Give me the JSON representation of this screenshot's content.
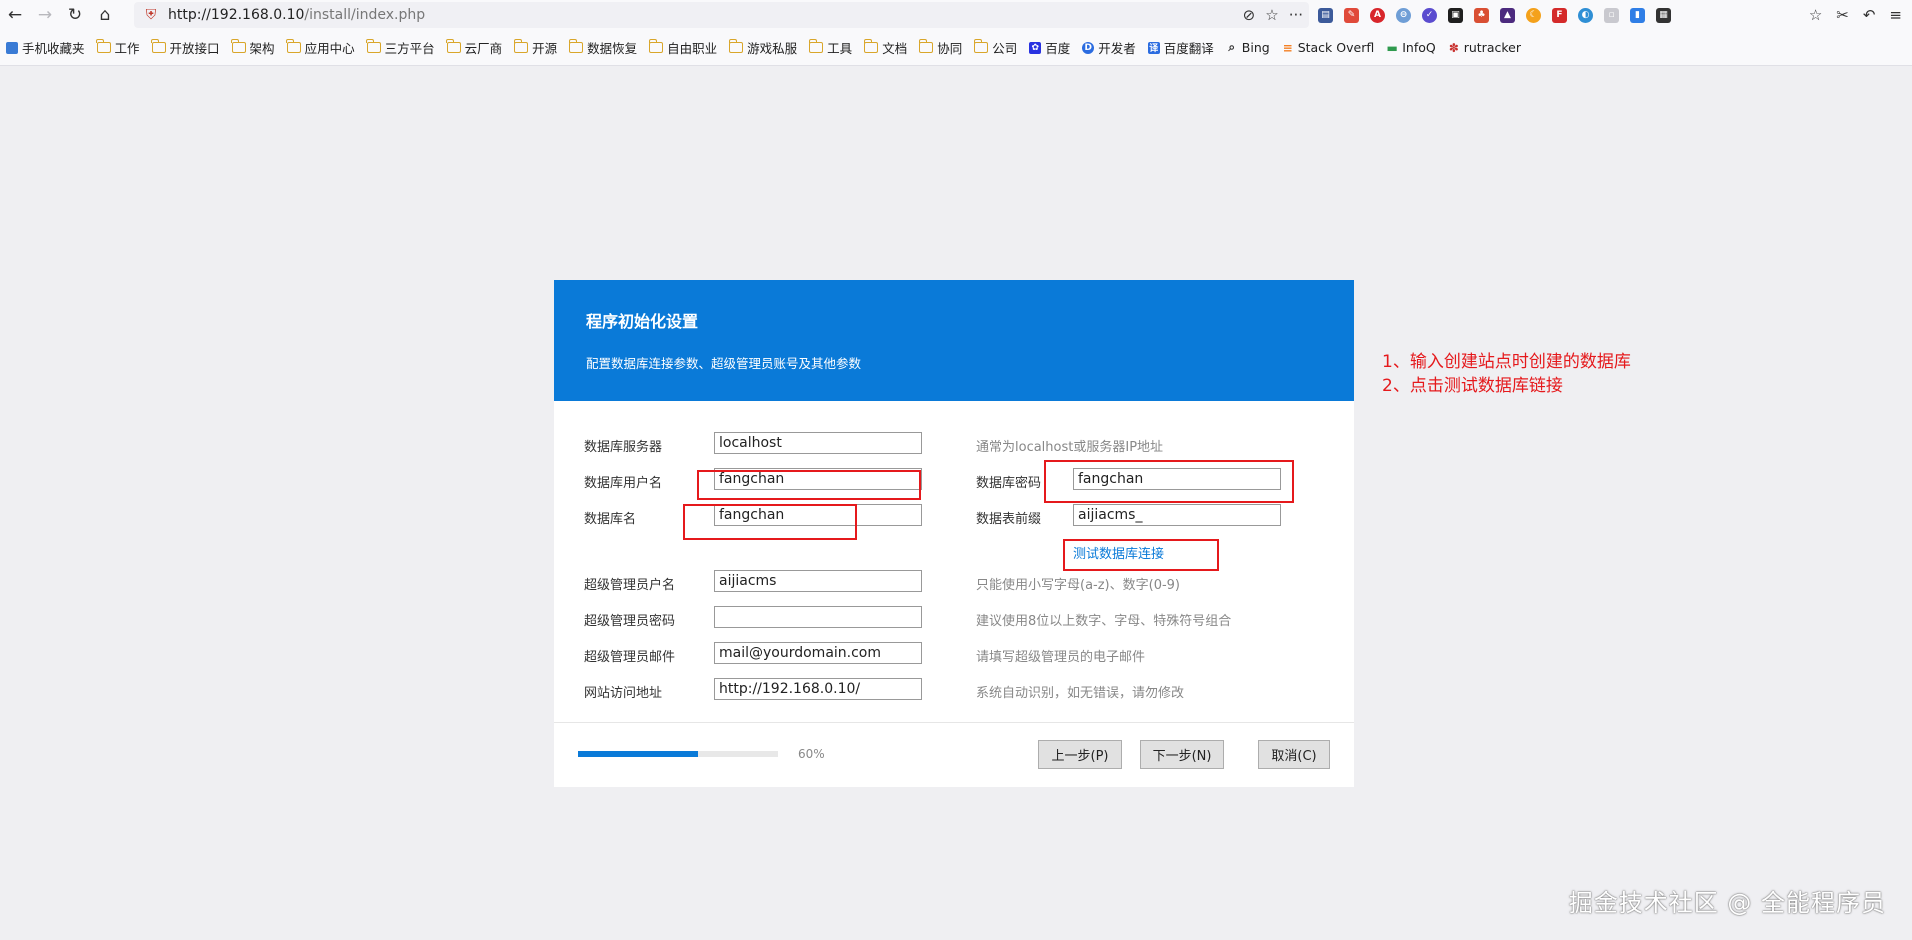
{
  "browser": {
    "url_host": "http://192.168.0.10",
    "url_path": "/install/index.php",
    "bookmarks": [
      {
        "label": "手机收藏夹",
        "icon": "mobile-icon"
      },
      {
        "label": "工作",
        "icon": "folder-icon"
      },
      {
        "label": "开放接口",
        "icon": "folder-icon"
      },
      {
        "label": "架构",
        "icon": "folder-icon"
      },
      {
        "label": "应用中心",
        "icon": "folder-icon"
      },
      {
        "label": "三方平台",
        "icon": "folder-icon"
      },
      {
        "label": "云厂商",
        "icon": "folder-icon"
      },
      {
        "label": "开源",
        "icon": "folder-icon"
      },
      {
        "label": "数据恢复",
        "icon": "folder-icon"
      },
      {
        "label": "自由职业",
        "icon": "folder-icon"
      },
      {
        "label": "游戏私服",
        "icon": "folder-icon"
      },
      {
        "label": "工具",
        "icon": "folder-icon"
      },
      {
        "label": "文档",
        "icon": "folder-icon"
      },
      {
        "label": "协同",
        "icon": "folder-icon"
      },
      {
        "label": "公司",
        "icon": "folder-icon"
      },
      {
        "label": "百度",
        "icon": "baidu-icon"
      },
      {
        "label": "开发者",
        "icon": "dev-icon"
      },
      {
        "label": "百度翻译",
        "icon": "translate-icon"
      },
      {
        "label": "Bing",
        "icon": "search-icon"
      },
      {
        "label": "Stack Overfl",
        "icon": "stackoverflow-icon"
      },
      {
        "label": "InfoQ",
        "icon": "infoq-icon"
      },
      {
        "label": "rutracker",
        "icon": "rutracker-icon"
      }
    ]
  },
  "dialog": {
    "title": "程序初始化设置",
    "subtitle": "配置数据库连接参数、超级管理员账号及其他参数",
    "accent_color": "#0a7ad8",
    "fields": {
      "db_server": {
        "label": "数据库服务器",
        "value": "localhost",
        "hint": "通常为localhost或服务器IP地址"
      },
      "db_user": {
        "label": "数据库用户名",
        "value": "fangchan"
      },
      "db_password": {
        "label": "数据库密码",
        "value": "fangchan"
      },
      "db_name": {
        "label": "数据库名",
        "value": "fangchan"
      },
      "db_prefix": {
        "label": "数据表前缀",
        "value": "aijiacms_"
      },
      "admin_user": {
        "label": "超级管理员户名",
        "value": "aijiacms",
        "hint": "只能使用小写字母(a-z)、数字(0-9)"
      },
      "admin_password": {
        "label": "超级管理员密码",
        "value": "",
        "hint": "建议使用8位以上数字、字母、特殊符号组合"
      },
      "admin_email": {
        "label": "超级管理员邮件",
        "value": "mail@yourdomain.com",
        "hint": "请填写超级管理员的电子邮件"
      },
      "site_url": {
        "label": "网站访问地址",
        "value": "http://192.168.0.10/",
        "hint": "系统自动识别，如无错误，请勿修改"
      }
    },
    "test_link": "测试数据库连接",
    "progress": {
      "percent": 60,
      "label": "60%"
    },
    "buttons": {
      "prev": "上一步(P)",
      "next": "下一步(N)",
      "cancel": "取消(C)"
    }
  },
  "annotations": {
    "color": "#e5191c",
    "note_1": "1、输入创建站点时创建的数据库",
    "note_2": "2、点击测试数据库链接"
  },
  "watermark": "掘金技术社区 @ 全能程序员"
}
